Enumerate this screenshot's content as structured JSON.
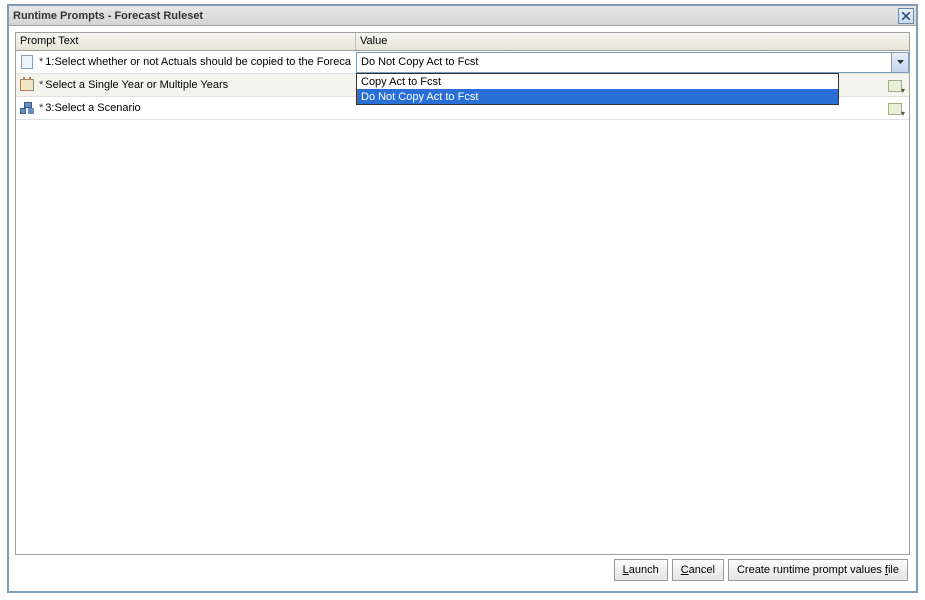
{
  "title": "Runtime Prompts - Forecast Ruleset",
  "headers": {
    "prompt": "Prompt Text",
    "value": "Value"
  },
  "rows": [
    {
      "label": "1:Select whether or not Actuals should be copied to the Foreca",
      "value": "Do Not Copy Act to Fcst",
      "icon": "doc",
      "hasCombo": true,
      "hasSelect": false
    },
    {
      "label": "Select a Single Year or Multiple Years",
      "value": "",
      "icon": "cal",
      "hasCombo": false,
      "hasSelect": true
    },
    {
      "label": "3:Select a Scenario",
      "value": "",
      "icon": "hier",
      "hasCombo": false,
      "hasSelect": true
    }
  ],
  "dropdown": {
    "options": [
      {
        "label": "Copy Act to Fcst",
        "selected": false
      },
      {
        "label": "Do Not Copy Act to Fcst",
        "selected": true
      }
    ]
  },
  "buttons": {
    "launch": {
      "pre": "",
      "hot": "L",
      "post": "aunch"
    },
    "cancel": {
      "pre": "",
      "hot": "C",
      "post": "ancel"
    },
    "createFile": {
      "pre": "Create runtime prompt values ",
      "hot": "f",
      "post": "ile"
    }
  }
}
